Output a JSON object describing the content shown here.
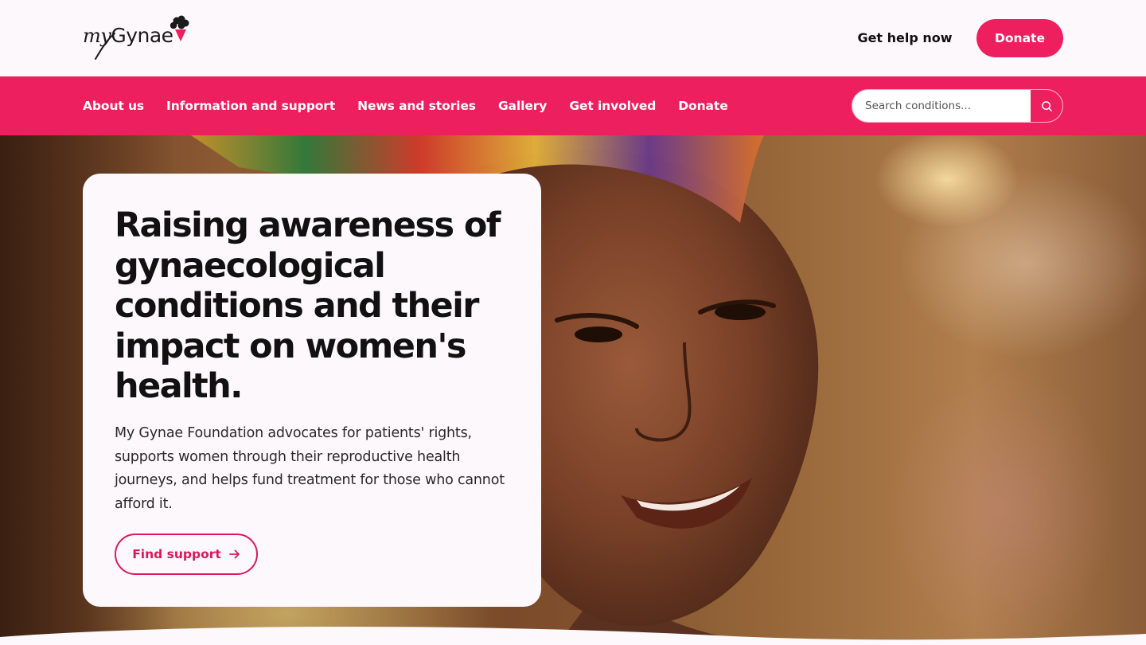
{
  "header": {
    "logo_text_my": "my",
    "logo_text_brand": "Gynae",
    "help_link": "Get help now",
    "donate_button": "Donate"
  },
  "nav": {
    "items": [
      {
        "label": "About us"
      },
      {
        "label": "Information and support"
      },
      {
        "label": "News and stories"
      },
      {
        "label": "Gallery"
      },
      {
        "label": "Get involved"
      },
      {
        "label": "Donate"
      }
    ],
    "search": {
      "placeholder": "Search conditions...",
      "icon": "search-icon"
    }
  },
  "hero": {
    "title": "Raising awareness of gynaecological conditions and their impact on women's health.",
    "description": "My Gynae Foundation advocates for patients' rights, supports women through their reproductive health journeys, and helps fund treatment for those who cannot afford it.",
    "cta_label": "Find support",
    "cta_icon": "arrow-right-icon"
  },
  "colors": {
    "brand_pink": "#ee1f5f",
    "page_background": "#fdf8fb",
    "text_dark": "#111111"
  }
}
